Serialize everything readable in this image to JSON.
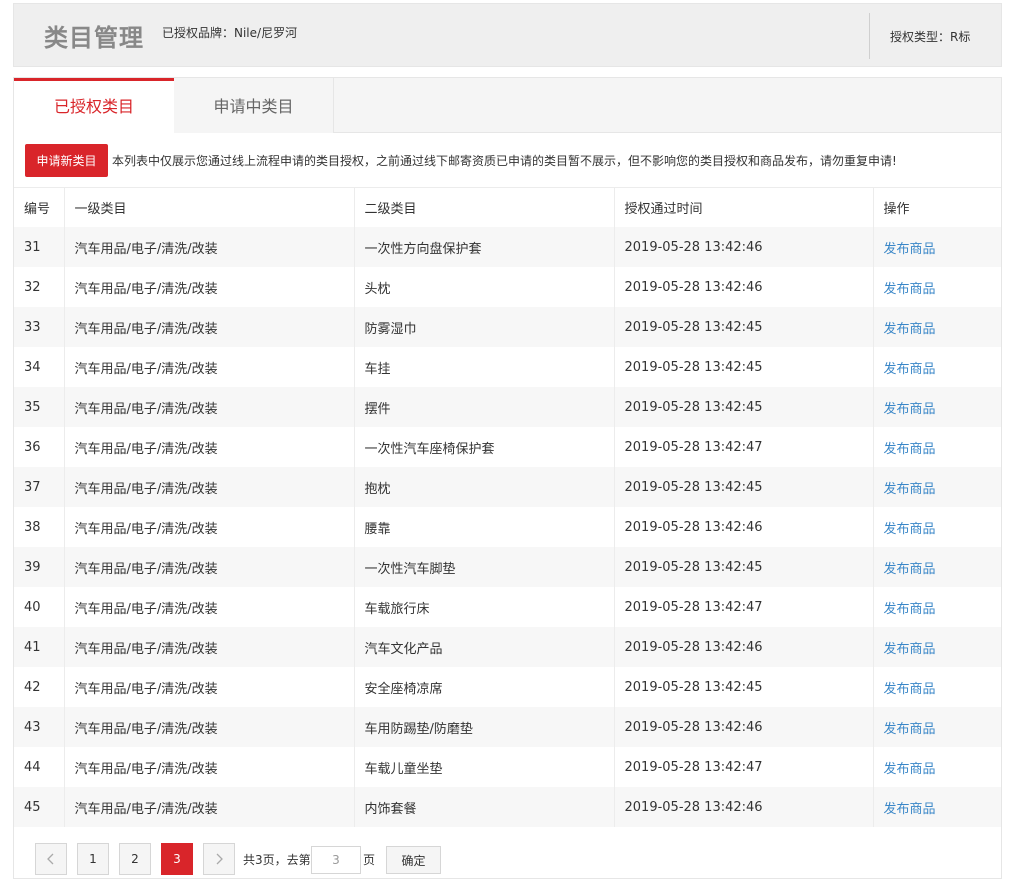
{
  "header": {
    "title": "类目管理",
    "brand_text": "已授权品牌：Nile/尼罗河",
    "auth_type_text": "授权类型：R标"
  },
  "tabs": [
    {
      "label": "已授权类目",
      "active": true
    },
    {
      "label": "申请中类目",
      "active": false
    }
  ],
  "toolbar": {
    "apply_button": "申请新类目",
    "notice": "本列表中仅展示您通过线上流程申请的类目授权，之前通过线下邮寄资质已申请的类目暂不展示，但不影响您的类目授权和商品发布，请勿重复申请!"
  },
  "table": {
    "columns": [
      "编号",
      "一级类目",
      "二级类目",
      "授权通过时间",
      "操作"
    ],
    "rows": [
      {
        "id": "31",
        "cat1": "汽车用品/电子/清洗/改装",
        "cat2": "一次性方向盘保护套",
        "time": "2019-05-28 13:42:46",
        "action": "发布商品"
      },
      {
        "id": "32",
        "cat1": "汽车用品/电子/清洗/改装",
        "cat2": "头枕",
        "time": "2019-05-28 13:42:46",
        "action": "发布商品"
      },
      {
        "id": "33",
        "cat1": "汽车用品/电子/清洗/改装",
        "cat2": "防雾湿巾",
        "time": "2019-05-28 13:42:45",
        "action": "发布商品"
      },
      {
        "id": "34",
        "cat1": "汽车用品/电子/清洗/改装",
        "cat2": "车挂",
        "time": "2019-05-28 13:42:45",
        "action": "发布商品"
      },
      {
        "id": "35",
        "cat1": "汽车用品/电子/清洗/改装",
        "cat2": "摆件",
        "time": "2019-05-28 13:42:45",
        "action": "发布商品"
      },
      {
        "id": "36",
        "cat1": "汽车用品/电子/清洗/改装",
        "cat2": "一次性汽车座椅保护套",
        "time": "2019-05-28 13:42:47",
        "action": "发布商品"
      },
      {
        "id": "37",
        "cat1": "汽车用品/电子/清洗/改装",
        "cat2": "抱枕",
        "time": "2019-05-28 13:42:45",
        "action": "发布商品"
      },
      {
        "id": "38",
        "cat1": "汽车用品/电子/清洗/改装",
        "cat2": "腰靠",
        "time": "2019-05-28 13:42:46",
        "action": "发布商品"
      },
      {
        "id": "39",
        "cat1": "汽车用品/电子/清洗/改装",
        "cat2": "一次性汽车脚垫",
        "time": "2019-05-28 13:42:45",
        "action": "发布商品"
      },
      {
        "id": "40",
        "cat1": "汽车用品/电子/清洗/改装",
        "cat2": "车载旅行床",
        "time": "2019-05-28 13:42:47",
        "action": "发布商品"
      },
      {
        "id": "41",
        "cat1": "汽车用品/电子/清洗/改装",
        "cat2": "汽车文化产品",
        "time": "2019-05-28 13:42:46",
        "action": "发布商品"
      },
      {
        "id": "42",
        "cat1": "汽车用品/电子/清洗/改装",
        "cat2": "安全座椅凉席",
        "time": "2019-05-28 13:42:45",
        "action": "发布商品"
      },
      {
        "id": "43",
        "cat1": "汽车用品/电子/清洗/改装",
        "cat2": "车用防踢垫/防磨垫",
        "time": "2019-05-28 13:42:46",
        "action": "发布商品"
      },
      {
        "id": "44",
        "cat1": "汽车用品/电子/清洗/改装",
        "cat2": "车载儿童坐垫",
        "time": "2019-05-28 13:42:47",
        "action": "发布商品"
      },
      {
        "id": "45",
        "cat1": "汽车用品/电子/清洗/改装",
        "cat2": "内饰套餐",
        "time": "2019-05-28 13:42:46",
        "action": "发布商品"
      }
    ]
  },
  "pagination": {
    "prev_icon": "chevron-left-icon",
    "next_icon": "chevron-right-icon",
    "pages": [
      "1",
      "2",
      "3"
    ],
    "current_page": "3",
    "total_text": "共3页，去第",
    "goto_value": "3",
    "page_unit": "页",
    "confirm_label": "确定"
  },
  "colors": {
    "accent": "#d9252a",
    "link": "#3a87c8"
  }
}
